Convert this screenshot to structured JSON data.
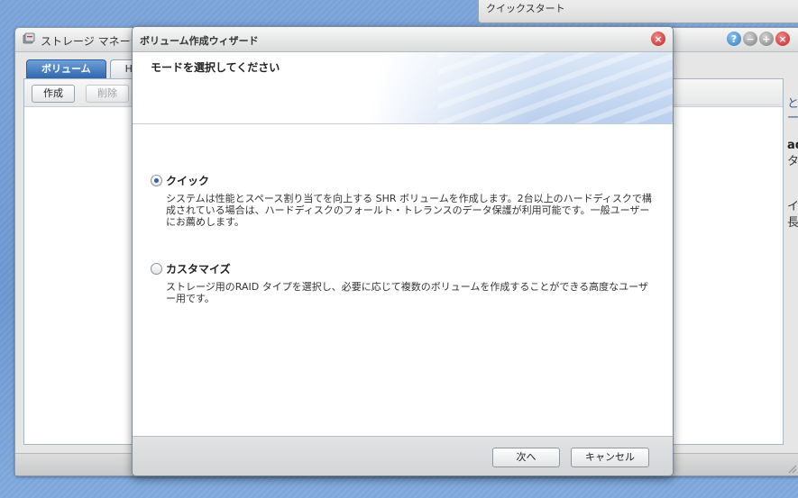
{
  "background_window": {
    "title": "クイックスタート"
  },
  "storage_manager": {
    "title": "ストレージ マネージャ",
    "tabs": [
      {
        "label": "ボリューム",
        "active": true
      },
      {
        "label": "H",
        "active": false
      }
    ],
    "toolbar": {
      "create_label": "作成",
      "delete_label": "削除"
    },
    "side_fragments": [
      "と",
      "ープ",
      "ad",
      "タ",
      "イ",
      "長カ"
    ]
  },
  "wizard": {
    "title": "ボリューム作成ウィザード",
    "heading": "モードを選択してください",
    "options": [
      {
        "label": "クイック",
        "selected": true,
        "description": "システムは性能とスペース割り当てを向上する SHR ボリュームを作成します。2台以上のハードディスクで構成されている場合は、ハードディスクのフォールト・トレランスのデータ保護が利用可能です。一般ユーザーにお薦めします。"
      },
      {
        "label": "カスタマイズ",
        "selected": false,
        "description": "ストレージ用のRAID タイプを選択し、必要に応じて複数のボリュームを作成することができる高度なユーザー用です。"
      }
    ],
    "next_label": "次へ",
    "cancel_label": "キャンセル"
  },
  "colors": {
    "accent": "#2f67ad",
    "close": "#c42020",
    "desktop": "#6f9bd3"
  }
}
